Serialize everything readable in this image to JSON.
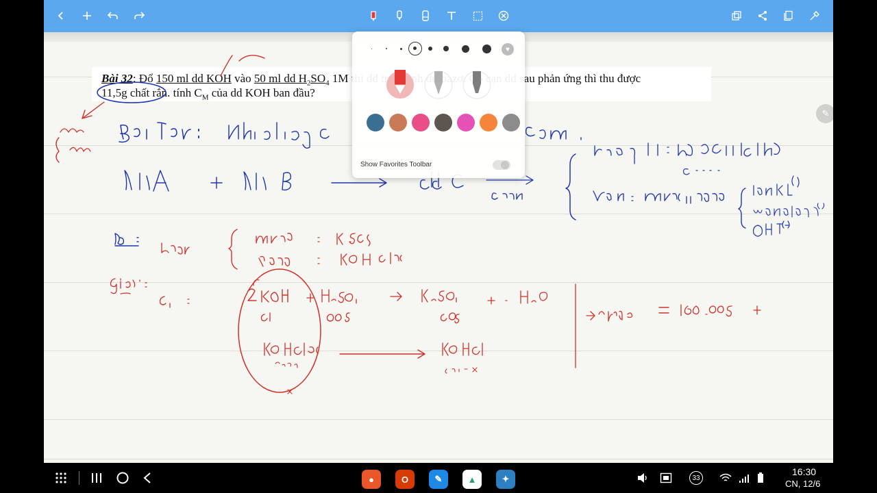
{
  "toolbar": {
    "left_icons": [
      "back-chevron-icon",
      "add-icon",
      "undo-icon",
      "redo-icon"
    ],
    "center_tools": [
      "pen-icon",
      "highlighter-icon",
      "eraser-icon",
      "text-icon",
      "selection-icon",
      "close-tool-icon"
    ],
    "right_icons": [
      "copy-icon",
      "share-icon",
      "pages-icon",
      "settings-icon"
    ],
    "background": "#5ba8ee"
  },
  "problem": {
    "number": "Bài 32",
    "line1_a": ": Đổ ",
    "vol_koh": "150 ml dd KOH",
    "line1_b": " vào ",
    "vol_h2so4": "50 ml dd H",
    "line1_c": "SO",
    "line1_d": " 1M thì dd trở thành dư bazơ. Cô cạn dd sau phản ứng thì thu được",
    "line2": "11,5g chất rắn. tính C",
    "line2_sub": "M",
    "line2_end": " của dd KOH ban đầu?"
  },
  "pen_popup": {
    "sizes": [
      1,
      2,
      3,
      5,
      6,
      8,
      11,
      13
    ],
    "selected_size_index": 3,
    "pen_styles": [
      "fountain-pen",
      "ballpoint-pen",
      "fineliner-pen"
    ],
    "selected_pen_index": 0,
    "colors": [
      "#3a6f92",
      "#c97a56",
      "#e94f86",
      "#5d5550",
      "#e651b6",
      "#f5853a",
      "#8c8c8c"
    ],
    "favorites_label": "Show Favorites Toolbar"
  },
  "handwriting_color_blue": "#1d35b0",
  "handwriting_color_red": "#d2312a",
  "navbar": {
    "apps": [
      {
        "name": "screen-recorder-icon",
        "color": "#e8562a",
        "glyph": "●"
      },
      {
        "name": "office-icon",
        "color": "#d83b01",
        "glyph": "O"
      },
      {
        "name": "pen-app-icon",
        "color": "#1e88e5",
        "glyph": "✎"
      },
      {
        "name": "drive-icon",
        "color": "#ffffff",
        "glyph": "▲"
      },
      {
        "name": "globe-app-icon",
        "color": "#2d7fc1",
        "glyph": "✦"
      }
    ],
    "badge": "33",
    "time": "16:30",
    "date": "CN, 12/6"
  }
}
